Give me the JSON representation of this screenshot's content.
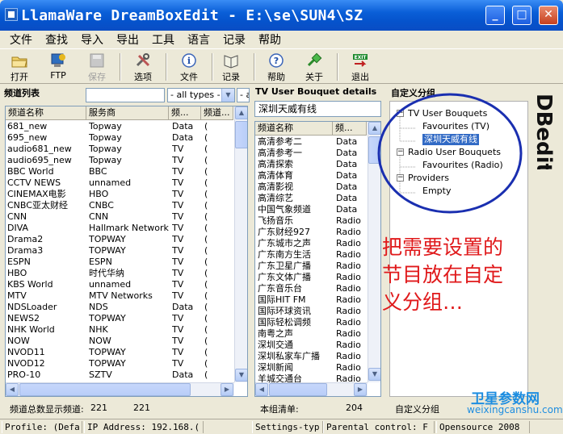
{
  "window": {
    "title": "LlamaWare DreamBoxEdit - E:\\se\\SUN4\\SZ",
    "minimize": "_",
    "maximize": "□",
    "close": "✕"
  },
  "menu": [
    "文件",
    "查找",
    "导入",
    "导出",
    "工具",
    "语言",
    "记录",
    "帮助"
  ],
  "toolbar": {
    "open": "打开",
    "ftp": "FTP",
    "save": "保存",
    "options": "选项",
    "file": "文件",
    "record": "记录",
    "help": "帮助",
    "about": "关于",
    "exit": "退出"
  },
  "channel_panel": {
    "title": "频道列表",
    "filter_types": "- all types -",
    "filter_all": "- a",
    "columns": [
      "频道名称",
      "服务商",
      "频...",
      "频道..."
    ],
    "rows": [
      [
        "681_new",
        "Topway",
        "Data",
        "("
      ],
      [
        "695_new",
        "Topway",
        "Data",
        "("
      ],
      [
        "audio681_new",
        "Topway",
        "TV",
        "("
      ],
      [
        "audio695_new",
        "Topway",
        "TV",
        "("
      ],
      [
        "BBC World",
        "BBC",
        "TV",
        "("
      ],
      [
        "CCTV NEWS",
        "unnamed",
        "TV",
        "("
      ],
      [
        "CINEMAX电影",
        "HBO",
        "TV",
        "("
      ],
      [
        "CNBC亚太财经",
        "CNBC",
        "TV",
        "("
      ],
      [
        "CNN",
        "CNN",
        "TV",
        "("
      ],
      [
        "DIVA",
        "Hallmark Network",
        "TV",
        "("
      ],
      [
        "Drama2",
        "TOPWAY",
        "TV",
        "("
      ],
      [
        "Drama3",
        "TOPWAY",
        "TV",
        "("
      ],
      [
        "ESPN",
        "ESPN",
        "TV",
        "("
      ],
      [
        "HBO",
        "时代华纳",
        "TV",
        "("
      ],
      [
        "KBS World",
        "unnamed",
        "TV",
        "("
      ],
      [
        "MTV",
        "MTV Networks",
        "TV",
        "("
      ],
      [
        "NDSLoader",
        "NDS",
        "Data",
        "("
      ],
      [
        "NEWS2",
        "TOPWAY",
        "TV",
        "("
      ],
      [
        "NHK World",
        "NHK",
        "TV",
        "("
      ],
      [
        "NOW",
        "NOW",
        "TV",
        "("
      ],
      [
        "NVOD11",
        "TOPWAY",
        "TV",
        "("
      ],
      [
        "NVOD12",
        "TOPWAY",
        "TV",
        "("
      ],
      [
        "PRO-10",
        "SZTV",
        "Data",
        "("
      ]
    ],
    "footer_label": "频道总数显示频道:",
    "footer_count1": "221",
    "footer_count2": "221"
  },
  "bouquet_panel": {
    "title": "TV User Bouquet details",
    "name": "深圳天威有线",
    "columns": [
      "频道名称",
      "频..."
    ],
    "rows": [
      [
        "高清参考二",
        "Data"
      ],
      [
        "高清参考一",
        "Data"
      ],
      [
        "高清探索",
        "Data"
      ],
      [
        "高清体育",
        "Data"
      ],
      [
        "高清影视",
        "Data"
      ],
      [
        "高清综艺",
        "Data"
      ],
      [
        "中国气象频道",
        "Data"
      ],
      [
        "飞扬音乐",
        "Radio"
      ],
      [
        "广东财经927",
        "Radio"
      ],
      [
        "广东城市之声",
        "Radio"
      ],
      [
        "广东南方生活",
        "Radio"
      ],
      [
        "广东卫星广播",
        "Radio"
      ],
      [
        "广东文体广播",
        "Radio"
      ],
      [
        "广东音乐台",
        "Radio"
      ],
      [
        "国际HIT FM",
        "Radio"
      ],
      [
        "国际环球资讯",
        "Radio"
      ],
      [
        "国际轻松调频",
        "Radio"
      ],
      [
        "南粤之声",
        "Radio"
      ],
      [
        "深圳交通",
        "Radio"
      ],
      [
        "深圳私家车广播",
        "Radio"
      ],
      [
        "深圳新闻",
        "Radio"
      ],
      [
        "羊城交通台",
        "Radio"
      ]
    ],
    "footer_label": "本组清单:",
    "footer_count": "204"
  },
  "custom_panel": {
    "title": "自定义分组",
    "tree": [
      {
        "label": "TV User Bouquets",
        "level": 0,
        "box": "−"
      },
      {
        "label": "Favourites (TV)",
        "level": 1
      },
      {
        "label": "深圳天威有线",
        "level": 1,
        "selected": true
      },
      {
        "label": "Radio User Bouquets",
        "level": 0,
        "box": "−"
      },
      {
        "label": "Favourites (Radio)",
        "level": 1
      },
      {
        "label": "Providers",
        "level": 0,
        "box": "−"
      },
      {
        "label": "Empty",
        "level": 1
      }
    ],
    "footer_label": "自定义分组",
    "logo_text": "DBedit"
  },
  "annotation": {
    "lines": [
      "把需要设置的",
      "节目放在自定",
      "义分组…"
    ],
    "color": "#e0191b"
  },
  "watermark": {
    "cn": "卫星参数网",
    "url": "weixingcanshu.com"
  },
  "statusbar": {
    "profile": "Profile: (Defa",
    "ip": "IP Address: 192.168.(",
    "settings": "Settings-typ",
    "parental": "Parental control: F",
    "version": "Opensource 2008"
  },
  "colors": {
    "title_bar": "#0553cc",
    "selection": "#316ac5",
    "circle": "#1a2fb0"
  }
}
